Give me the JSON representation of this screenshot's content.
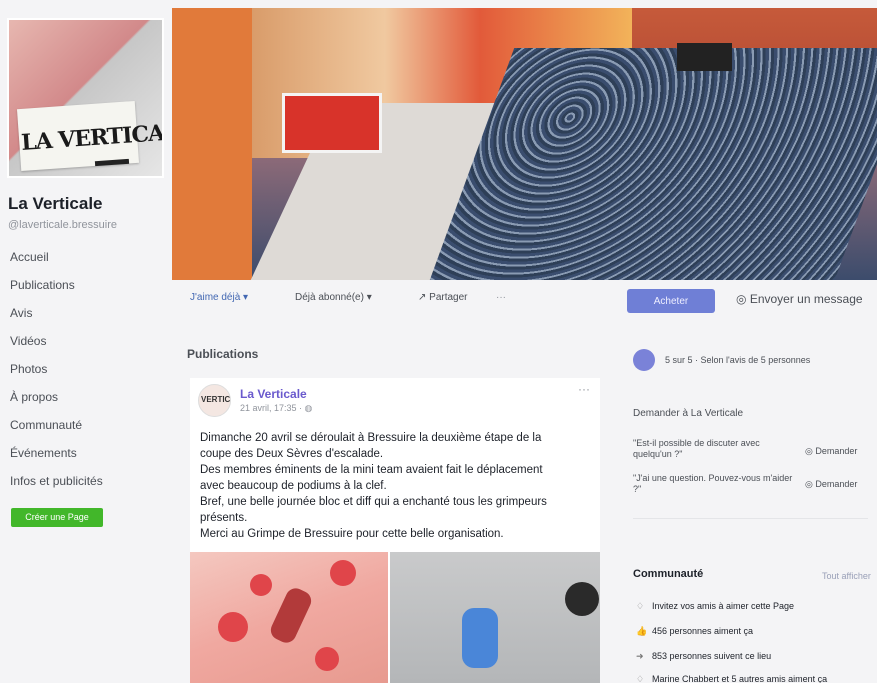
{
  "sidebar": {
    "page_name": "La Verticale",
    "page_handle": "@laverticale.bressuire",
    "logo_text": "LA VERTICALE",
    "nav": [
      "Accueil",
      "Publications",
      "Avis",
      "Vidéos",
      "Photos",
      "À propos",
      "Communauté",
      "Événements",
      "Infos et publicités"
    ],
    "create_page_label": "Créer une Page"
  },
  "actions": {
    "like_label": "J'aime déjà ▾",
    "follow_label": "Déjà abonné(e) ▾",
    "share_label": "↗ Partager",
    "more_label": "···",
    "learn_more_label": "Acheter",
    "message_label": "Envoyer un message"
  },
  "publications": {
    "title": "Publications",
    "post": {
      "author": "La Verticale",
      "date": "21 avril, 17:35 · ",
      "avatar_text": "VERTIC",
      "more_label": "···",
      "text_lines": [
        "Dimanche 20 avril se déroulait à Bressuire la deuxième étape de la",
        "coupe des Deux Sèvres d'escalade.",
        "Des membres éminents de la mini team avaient fait le déplacement",
        "avec beaucoup de podiums à la clef.",
        "Bref, une belle journée bloc et diff qui a enchanté tous les grimpeurs",
        "présents.",
        "Merci au Grimpe de Bressuire pour cette belle organisation."
      ]
    }
  },
  "right": {
    "rating_text": "5 sur 5 · Selon l'avis de 5 personnes",
    "ask_title": "Demander à La Verticale",
    "questions": [
      {
        "text": "\"Est-il possible de discuter avec quelqu'un ?\"",
        "button": "Demander"
      },
      {
        "text": "\"J'ai une question. Pouvez-vous m'aider ?\"",
        "button": "Demander"
      }
    ],
    "community_title": "Communauté",
    "community_all": "Tout afficher",
    "community_rows": [
      {
        "icon": "♢",
        "text": "Invitez vos amis à aimer cette Page"
      },
      {
        "icon": "👍",
        "text": "456 personnes aiment ça"
      },
      {
        "icon": "➜",
        "text": "853 personnes suivent ce lieu"
      },
      {
        "icon": "♢",
        "text": "Marine Chabbert et 5 autres amis aiment ça"
      }
    ]
  },
  "colors": {
    "accent": "#4267b2",
    "button": "#6f7fd6",
    "create_green": "#42b72a"
  }
}
